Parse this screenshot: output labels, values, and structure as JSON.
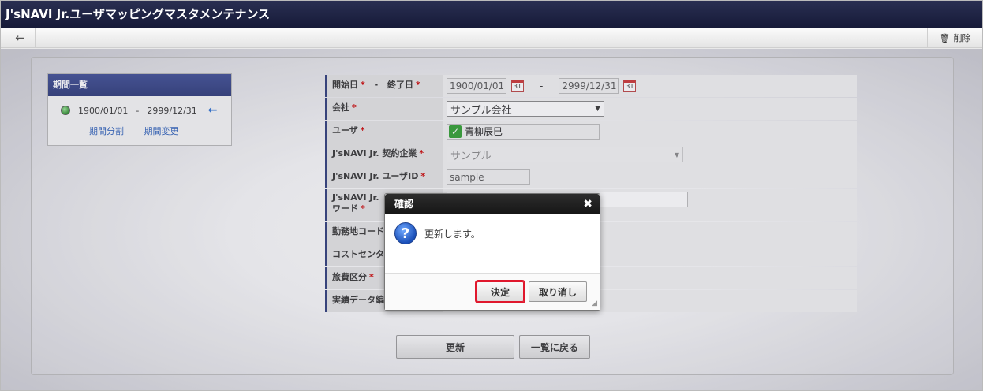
{
  "window": {
    "title": "J'sNAVI Jr.ユーザマッピングマスタメンテナンス"
  },
  "toolbar": {
    "back_icon": "arrow-left-icon",
    "delete_label": "削除",
    "delete_icon": "trash-icon"
  },
  "period": {
    "header": "期間一覧",
    "start": "1900/01/01",
    "separator": "-",
    "end": "2999/12/31",
    "split_label": "期間分割",
    "change_label": "期間変更"
  },
  "form": {
    "start_label": "開始日",
    "dash": "-",
    "end_label": "終了日",
    "start_value": "1900/01/01",
    "end_value": "2999/12/31",
    "company_label": "会社",
    "company_value": "サンプル会社",
    "user_label": "ユーザ",
    "user_value": "青柳辰巳",
    "contract_label": "J'sNAVI Jr. 契約企業",
    "contract_value": "サンプル",
    "userid_label": "J'sNAVI Jr. ユーザID",
    "userid_value": "sample",
    "password_label_1": "J'sNAVI Jr. ",
    "password_label_2": "ワード",
    "workplace_label": "勤務地コード",
    "costcenter_label": "コストセンタ",
    "travel_label": "旅費区分",
    "actual_label": "実績データ編",
    "required_mark": "*"
  },
  "buttons": {
    "update": "更新",
    "back_to_list": "一覧に戻る"
  },
  "dialog": {
    "title": "確認",
    "message": "更新します。",
    "ok": "決定",
    "cancel": "取り消し",
    "close_icon": "close-icon"
  },
  "colors": {
    "title_bar": "#1c2042",
    "accent": "#2c3a78",
    "highlight": "#e0182d"
  }
}
